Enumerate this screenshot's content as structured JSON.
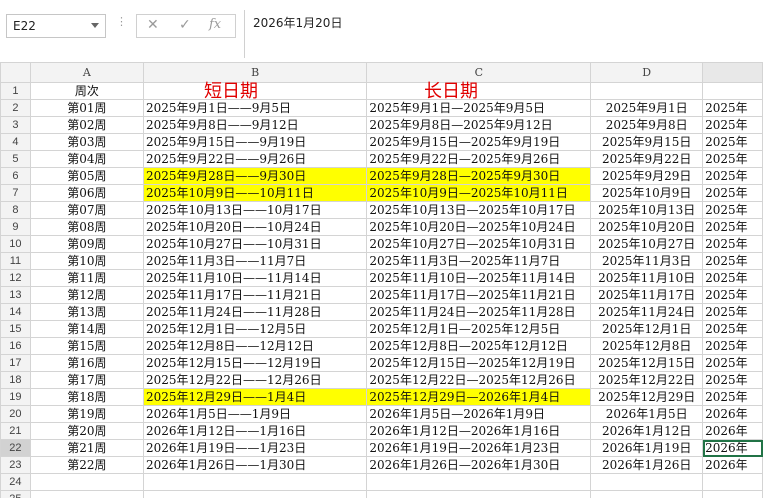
{
  "formula_bar": {
    "name_box": "E22",
    "cancel_icon": "✕",
    "enter_icon": "✓",
    "fx_label": "fx",
    "formula": "2026年1月20日"
  },
  "columns": [
    "A",
    "B",
    "C",
    "D"
  ],
  "header_row": {
    "A": "周次"
  },
  "annotations": {
    "short": "短日期",
    "long": "长日期"
  },
  "rows": [
    {
      "n": "2",
      "week": "第01周",
      "b": "2025年9月1日——9月5日",
      "c": "2025年9月1日—2025年9月5日",
      "d": "2025年9月1日",
      "e": "2025年"
    },
    {
      "n": "3",
      "week": "第02周",
      "b": "2025年9月8日——9月12日",
      "c": "2025年9月8日—2025年9月12日",
      "d": "2025年9月8日",
      "e": "2025年"
    },
    {
      "n": "4",
      "week": "第03周",
      "b": "2025年9月15日——9月19日",
      "c": "2025年9月15日—2025年9月19日",
      "d": "2025年9月15日",
      "e": "2025年"
    },
    {
      "n": "5",
      "week": "第04周",
      "b": "2025年9月22日——9月26日",
      "c": "2025年9月22日—2025年9月26日",
      "d": "2025年9月22日",
      "e": "2025年"
    },
    {
      "n": "6",
      "week": "第05周",
      "b": "2025年9月28日——9月30日",
      "c": "2025年9月28日—2025年9月30日",
      "d": "2025年9月29日",
      "e": "2025年",
      "hl": true
    },
    {
      "n": "7",
      "week": "第06周",
      "b": "2025年10月9日——10月11日",
      "c": "2025年10月9日—2025年10月11日",
      "d": "2025年10月9日",
      "e": "2025年",
      "hl": true
    },
    {
      "n": "8",
      "week": "第07周",
      "b": "2025年10月13日——10月17日",
      "c": "2025年10月13日—2025年10月17日",
      "d": "2025年10月13日",
      "e": "2025年"
    },
    {
      "n": "9",
      "week": "第08周",
      "b": "2025年10月20日——10月24日",
      "c": "2025年10月20日—2025年10月24日",
      "d": "2025年10月20日",
      "e": "2025年"
    },
    {
      "n": "10",
      "week": "第09周",
      "b": "2025年10月27日——10月31日",
      "c": "2025年10月27日—2025年10月31日",
      "d": "2025年10月27日",
      "e": "2025年"
    },
    {
      "n": "11",
      "week": "第10周",
      "b": "2025年11月3日——11月7日",
      "c": "2025年11月3日—2025年11月7日",
      "d": "2025年11月3日",
      "e": "2025年"
    },
    {
      "n": "12",
      "week": "第11周",
      "b": "2025年11月10日——11月14日",
      "c": "2025年11月10日—2025年11月14日",
      "d": "2025年11月10日",
      "e": "2025年"
    },
    {
      "n": "13",
      "week": "第12周",
      "b": "2025年11月17日——11月21日",
      "c": "2025年11月17日—2025年11月21日",
      "d": "2025年11月17日",
      "e": "2025年"
    },
    {
      "n": "14",
      "week": "第13周",
      "b": "2025年11月24日——11月28日",
      "c": "2025年11月24日—2025年11月28日",
      "d": "2025年11月24日",
      "e": "2025年"
    },
    {
      "n": "15",
      "week": "第14周",
      "b": "2025年12月1日——12月5日",
      "c": "2025年12月1日—2025年12月5日",
      "d": "2025年12月1日",
      "e": "2025年"
    },
    {
      "n": "16",
      "week": "第15周",
      "b": "2025年12月8日——12月12日",
      "c": "2025年12月8日—2025年12月12日",
      "d": "2025年12月8日",
      "e": "2025年"
    },
    {
      "n": "17",
      "week": "第16周",
      "b": "2025年12月15日——12月19日",
      "c": "2025年12月15日—2025年12月19日",
      "d": "2025年12月15日",
      "e": "2025年"
    },
    {
      "n": "18",
      "week": "第17周",
      "b": "2025年12月22日——12月26日",
      "c": "2025年12月22日—2025年12月26日",
      "d": "2025年12月22日",
      "e": "2025年"
    },
    {
      "n": "19",
      "week": "第18周",
      "b": "2025年12月29日——1月4日",
      "c": "2025年12月29日—2026年1月4日",
      "d": "2025年12月29日",
      "e": "2025年",
      "hl": true
    },
    {
      "n": "20",
      "week": "第19周",
      "b": "2026年1月5日——1月9日",
      "c": "2026年1月5日—2026年1月9日",
      "d": "2026年1月5日",
      "e": "2026年"
    },
    {
      "n": "21",
      "week": "第20周",
      "b": "2026年1月12日——1月16日",
      "c": "2026年1月12日—2026年1月16日",
      "d": "2026年1月12日",
      "e": "2026年"
    },
    {
      "n": "22",
      "week": "第21周",
      "b": "2026年1月19日——1月23日",
      "c": "2026年1月19日—2026年1月23日",
      "d": "2026年1月19日",
      "e": "2026年",
      "sel": true
    },
    {
      "n": "23",
      "week": "第22周",
      "b": "2026年1月26日——1月30日",
      "c": "2026年1月26日—2026年1月30日",
      "d": "2026年1月26日",
      "e": "2026年"
    }
  ],
  "empty_rows": [
    "24",
    "25"
  ]
}
